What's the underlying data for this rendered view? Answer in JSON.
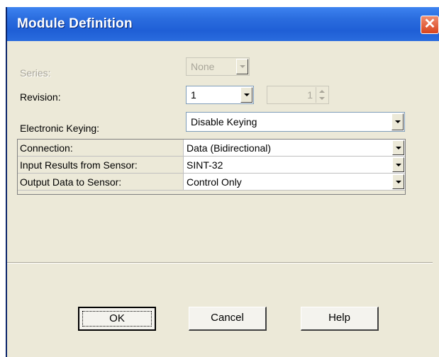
{
  "dialog": {
    "title": "Module Definition",
    "close_icon": "close-icon",
    "close_glyph": "✕"
  },
  "series": {
    "label": "Series:",
    "value": "None",
    "enabled": false
  },
  "revision": {
    "label": "Revision:",
    "major_value": "1",
    "minor_value": "1",
    "minor_enabled": false
  },
  "keying": {
    "label": "Electronic Keying:",
    "value": "Disable Keying"
  },
  "properties": [
    {
      "key": "Connection:",
      "value": "Data (Bidirectional)"
    },
    {
      "key": "Input Results from Sensor:",
      "value": "SINT-32"
    },
    {
      "key": "Output Data to Sensor:",
      "value": "Control Only"
    }
  ],
  "buttons": {
    "ok": "OK",
    "cancel": "Cancel",
    "help": "Help"
  },
  "colors": {
    "titlebar": "#2a6cde",
    "dialog_bg": "#ece9d8",
    "close": "#d8431d"
  }
}
